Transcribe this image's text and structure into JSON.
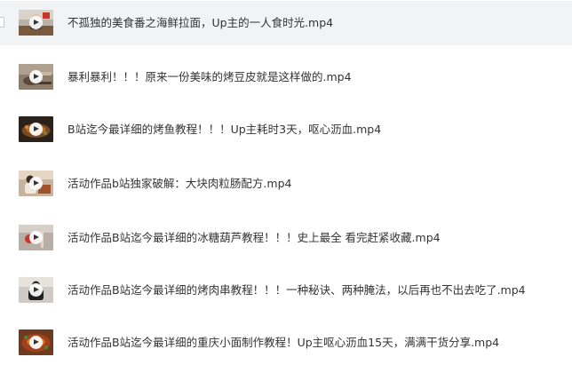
{
  "files": [
    {
      "name": "不孤独的美食番之海鲜拉面，Up主的一人食时光.mp4",
      "thumb": "person-at-table-thumbnail",
      "selected": true
    },
    {
      "name": "暴利暴利！！！原来一份美味的烤豆皮就是这样做的.mp4",
      "thumb": "grilled-tofu-skin-thumbnail",
      "selected": false
    },
    {
      "name": "B站迄今最详细的烤鱼教程！！！Up主耗时3天，呕心沥血.mp4",
      "thumb": "grilled-fish-thumbnail",
      "selected": false
    },
    {
      "name": "活动作品b站独家破解：大块肉粒肠配方.mp4",
      "thumb": "person-cooking-thumbnail",
      "selected": false
    },
    {
      "name": "活动作品B站迄今最详细的冰糖葫芦教程！！！史上最全 看完赶紧收藏.mp4",
      "thumb": "candied-haws-thumbnail",
      "selected": false
    },
    {
      "name": "活动作品B站迄今最详细的烤肉串教程！！！一种秘诀、两种腌法，以后再也不出去吃了.mp4",
      "thumb": "person-in-mask-thumbnail",
      "selected": false
    },
    {
      "name": "活动作品B站迄今最详细的重庆小面制作教程！Up主呕心沥血15天，满满干货分享.mp4",
      "thumb": "chongqing-noodles-thumbnail",
      "selected": false
    }
  ],
  "icons": {
    "play": "play-icon",
    "checkbox": "checkbox-icon"
  },
  "colors": {
    "selected_row_bg": "#f2f3f5",
    "text": "#333333"
  }
}
